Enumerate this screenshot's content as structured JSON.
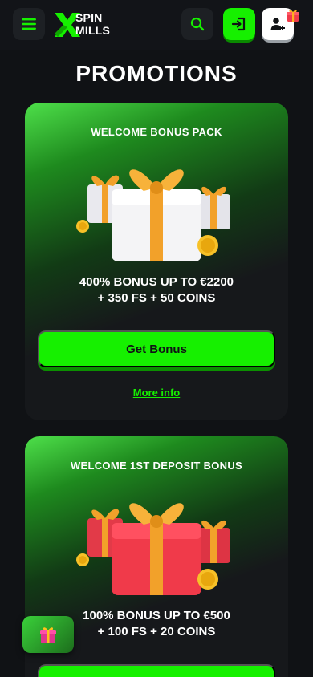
{
  "header": {
    "logo_line1": "SPIN",
    "logo_line2": "MILLS"
  },
  "page_title": "PROMOTIONS",
  "promotions": [
    {
      "title": "WELCOME BONUS PACK",
      "desc_line1": "400% BONUS UP TO €2200",
      "desc_line2": "+ 350 FS + 50 COINS",
      "button_label": "Get Bonus",
      "link_label": "More info",
      "gift_color": "#f4f4f6"
    },
    {
      "title": "WELCOME 1ST DEPOSIT BONUS",
      "desc_line1": "100% BONUS UP TO €500",
      "desc_line2": "+ 100 FS + 20 COINS",
      "button_label": "",
      "gift_color": "#f03a4a"
    }
  ],
  "colors": {
    "accent": "#16f000",
    "background": "#101215"
  },
  "icons": {
    "menu": "hamburger-icon",
    "search": "search-icon",
    "login": "login-icon",
    "signup": "user-plus-icon",
    "gift": "gift-icon"
  }
}
